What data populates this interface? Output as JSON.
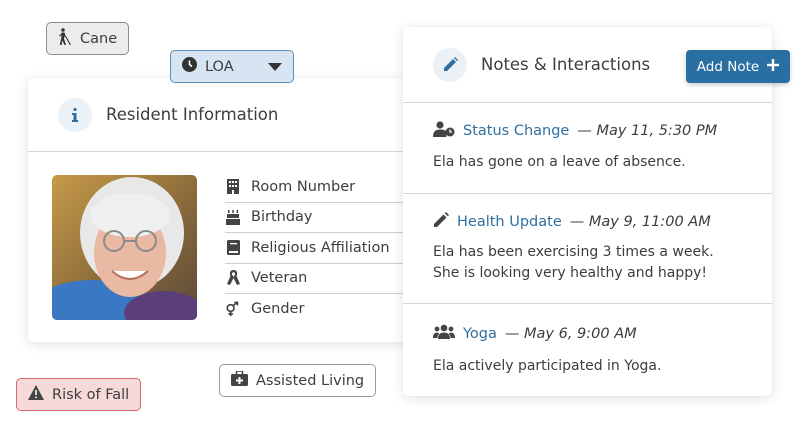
{
  "tags": {
    "cane": {
      "label": "Cane",
      "icon": "blind-person-icon"
    },
    "loa": {
      "label": "LOA",
      "icon": "clock-icon"
    },
    "risk_of_fall": {
      "label": "Risk of Fall",
      "icon": "warning-icon"
    },
    "assisted_living": {
      "label": "Assisted Living",
      "icon": "medical-kit-icon"
    }
  },
  "resident": {
    "title": "Resident Information",
    "fields": [
      {
        "label": "Room Number",
        "icon": "building-icon"
      },
      {
        "label": "Birthday",
        "icon": "cake-icon"
      },
      {
        "label": "Religious Affiliation",
        "icon": "book-icon"
      },
      {
        "label": "Veteran",
        "icon": "ribbon-icon"
      },
      {
        "label": "Gender",
        "icon": "gender-icon"
      }
    ]
  },
  "notes": {
    "title": "Notes & Interactions",
    "add_label": "Add Note",
    "items": [
      {
        "type": "Status Change",
        "meta": "— May 11, 5:30 PM",
        "body": "Ela has gone on a leave of absence.",
        "icon": "user-clock-icon"
      },
      {
        "type": "Health Update",
        "meta": "— May 9, 11:00 AM",
        "body": "Ela has been exercising 3 times a week. She is looking very healthy and happy!",
        "icon": "pencil-icon"
      },
      {
        "type": "Yoga",
        "meta": "— May 6, 9:00 AM",
        "body": "Ela actively participated in Yoga.",
        "icon": "group-icon"
      }
    ]
  },
  "colors": {
    "accent": "#2a6fa1",
    "link": "#2f6fa0",
    "danger": "#d9686a"
  }
}
